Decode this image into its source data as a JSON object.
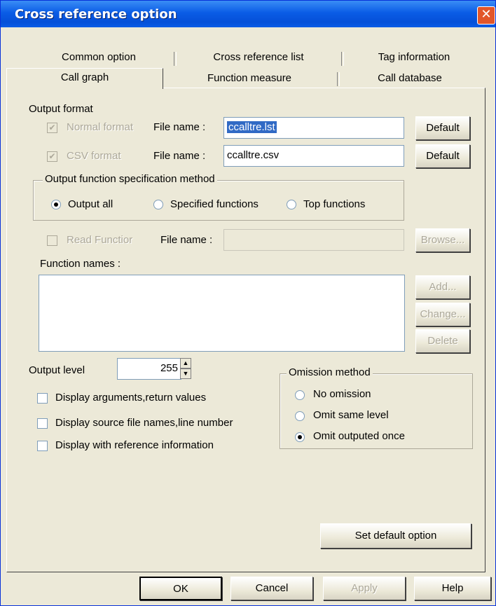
{
  "window": {
    "title": "Cross reference option",
    "close_glyph": "✕"
  },
  "tabs_back": [
    {
      "label": "Common option"
    },
    {
      "label": "Cross reference list"
    },
    {
      "label": "Tag information"
    }
  ],
  "tabs_front": [
    {
      "label": "Call graph",
      "active": true
    },
    {
      "label": "Function measure"
    },
    {
      "label": "Call database"
    }
  ],
  "output_format": {
    "heading": "Output format",
    "normal": {
      "label": "Normal format",
      "checked": true,
      "file_label": "File name :",
      "file_value": "ccalltre.lst",
      "default_button": "Default"
    },
    "csv": {
      "label": "CSV format",
      "checked": true,
      "file_label": "File name :",
      "file_value": "ccalltre.csv",
      "default_button": "Default"
    }
  },
  "spec_method": {
    "heading": "Output function specification method",
    "options": [
      "Output all",
      "Specified functions",
      "Top functions"
    ],
    "selected": "Output all"
  },
  "read_function": {
    "label": "Read Functior",
    "file_label": "File name :",
    "file_value": "",
    "browse_button": "Browse..."
  },
  "function_names": {
    "label": "Function names :",
    "add_button": "Add...",
    "change_button": "Change...",
    "delete_button": "Delete"
  },
  "output_level": {
    "label": "Output level",
    "value": "255"
  },
  "display_options": [
    {
      "label": "Display arguments,return values",
      "checked": false
    },
    {
      "label": "Display source file names,line number",
      "checked": false
    },
    {
      "label": "Display with reference information",
      "checked": false
    }
  ],
  "omission": {
    "heading": "Omission method",
    "options": [
      "No omission",
      "Omit same level",
      "Omit outputed once"
    ],
    "selected": "Omit outputed once"
  },
  "set_default_button": "Set default option",
  "footer": {
    "ok": "OK",
    "cancel": "Cancel",
    "apply": "Apply",
    "help": "Help"
  }
}
